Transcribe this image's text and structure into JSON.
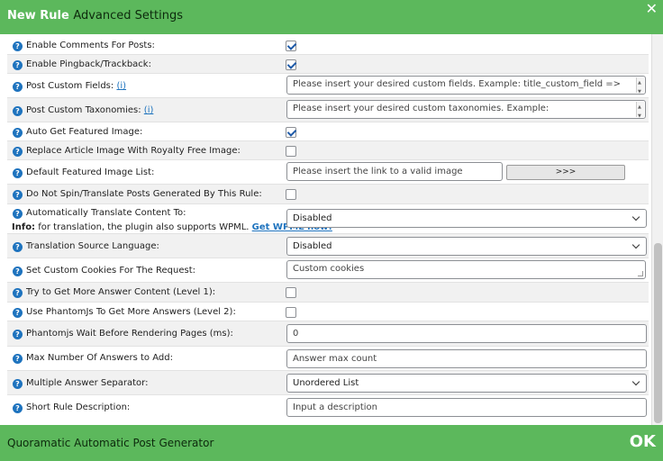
{
  "header": {
    "title_main": "New Rule",
    "title_sub": "Advanced Settings",
    "close": "✕"
  },
  "footer": {
    "title": "Quoramatic Automatic Post Generator",
    "ok": "OK"
  },
  "help_icon": "?",
  "info_marker": "(i)",
  "rows": {
    "comments": {
      "label": "Enable Comments For Posts:",
      "checked": true
    },
    "pingback": {
      "label": "Enable Pingback/Trackback:",
      "checked": true
    },
    "custom_fields": {
      "label": "Post Custom Fields:",
      "placeholder": "Please insert your desired custom fields. Example: title_custom_field =>"
    },
    "custom_taxonomies": {
      "label": "Post Custom Taxonomies:",
      "placeholder": "Please insert your desired custom taxonomies. Example:"
    },
    "auto_featured": {
      "label": "Auto Get Featured Image:",
      "checked": true
    },
    "royalty_free": {
      "label": "Replace Article Image With Royalty Free Image:",
      "checked": false
    },
    "default_featured": {
      "label": "Default Featured Image List:",
      "placeholder": "Please insert the link to a valid image",
      "button": ">>>"
    },
    "no_spin": {
      "label": "Do Not Spin/Translate Posts Generated By This Rule:",
      "checked": false
    },
    "translate": {
      "label": "Automatically Translate Content To:",
      "info_prefix": "Info:",
      "info_text": " for translation, the plugin also supports WPML. ",
      "info_link": "Get WPML now!",
      "value": "Disabled"
    },
    "source_lang": {
      "label": "Translation Source Language:",
      "value": "Disabled"
    },
    "cookies": {
      "label": "Set Custom Cookies For The Request:",
      "placeholder": "Custom cookies"
    },
    "more_answers_1": {
      "label": "Try to Get More Answer Content (Level 1):",
      "checked": false
    },
    "phantomjs": {
      "label": "Use PhantomJs To Get More Answers (Level 2):",
      "checked": false
    },
    "phantom_wait": {
      "label": "Phantomjs Wait Before Rendering Pages (ms):",
      "value": "0"
    },
    "max_answers": {
      "label": "Max Number Of Answers to Add:",
      "placeholder": "Answer max count"
    },
    "separator": {
      "label": "Multiple Answer Separator:",
      "value": "Unordered List"
    },
    "short_desc": {
      "label": "Short Rule Description:",
      "placeholder": "Input a description"
    }
  }
}
